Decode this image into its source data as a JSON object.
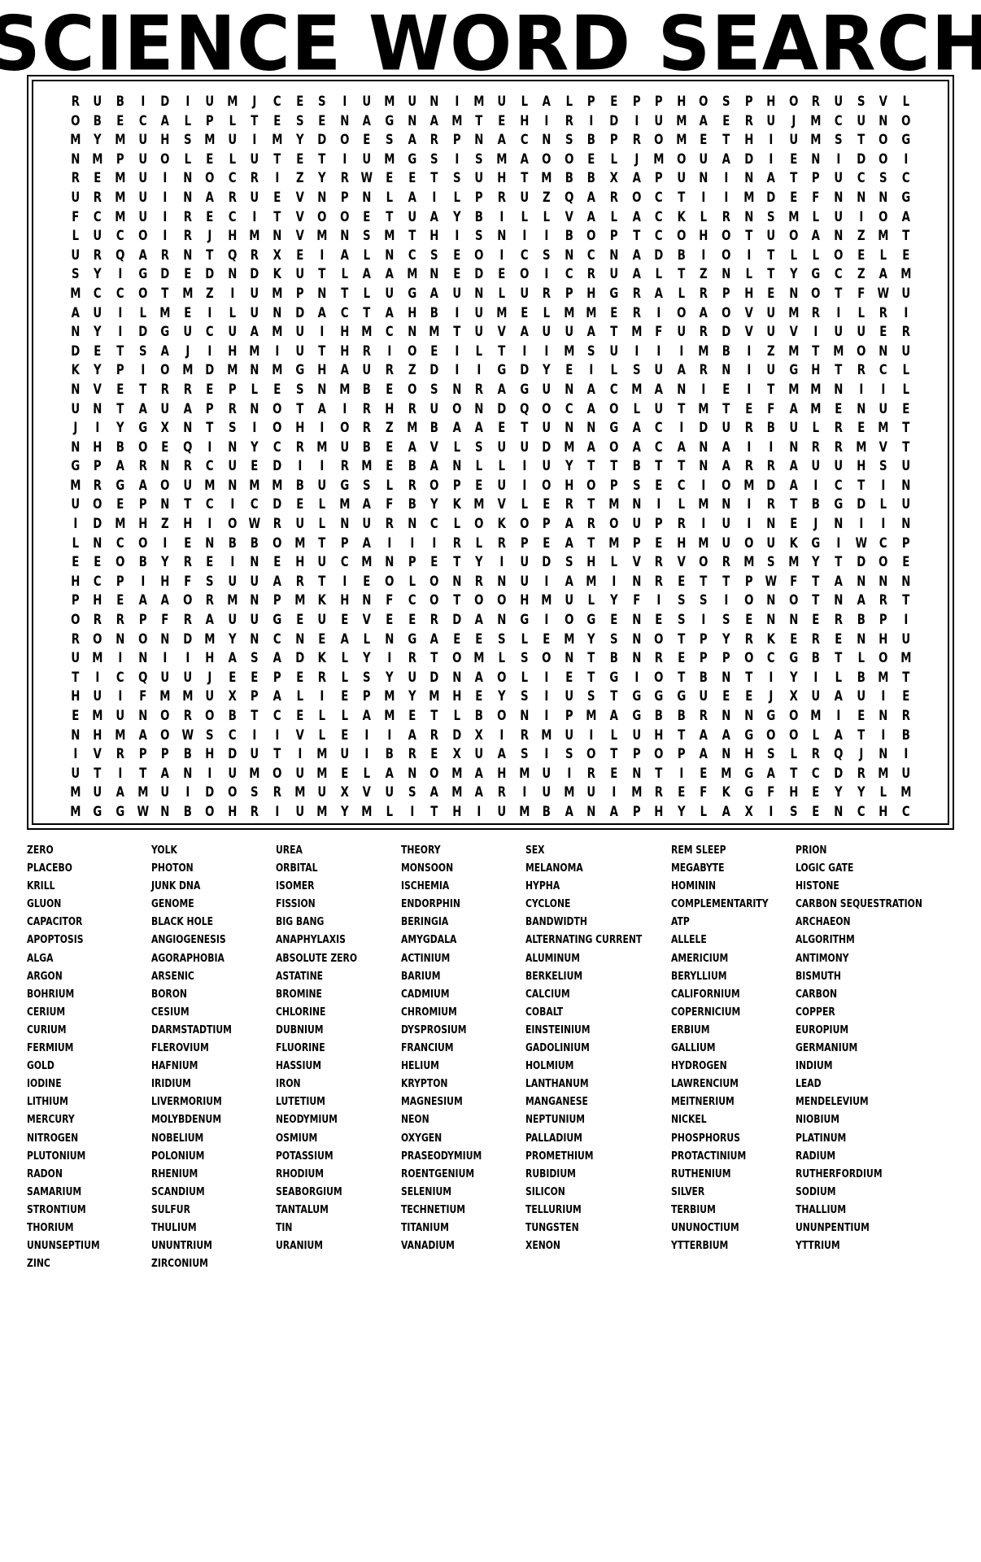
{
  "title": "SCIENCE WORD SEARCH",
  "grid": {
    "rows": 38,
    "cols": 38,
    "letters": [
      "RUBIDIUMJCESIUMUNIMULALPEPPHOSPHORUSVL",
      "OBECALPLTESENAGNAMTEHIRIDIUMAERUJMCUNO",
      "MYMUHSMUIMYDOESARPNACNSBPROMETHIUMSTOG",
      "NMPUOLELUTETIUMGSISMAOOELJMOUADIENIDOI",
      "REMUINOCRIZYRWEETSUHTMBBXAPUNINATPUCSC",
      "URMUINARUEVNPNLAILPRUZQAROCTIIMDEFNNNG",
      "FCMUIRECITVOOETUAYBILLVALACKLRNSMLUIOA",
      "LUCOIRJHMNVMNSMTHISNIIBOPTCOHOTUOANZMT",
      "URQARNTQRXEIALNCSEOICSNCNADBIOITLLOELE",
      "SYIGDEDNDKUTLAAMNEDEOICRUALTZNLTYGCZAM",
      "MCCOTMZIUMPNTLUGAUNLURPHGRALRPHENOTFWU",
      "AUILMEILUNDACTAHBIUMELMMERIOAOVUMRILRI",
      "NYIDGUCUAMUIHMCNMTUVAUUATMFURDVUVIUUER",
      "DETSAJIHMIUTHRIOEILTIIMSUIIIMBIZMTMONU",
      "KYPIOMDMNMGHAURZDIIGDYEILSUARNIUGHTRCL",
      "NVETRREPLESNMBEOSNRAGUNACMANIEITMMNIIL",
      "UNTAUAPRNOTAIRHRUONDQOCAOLUTMTEFAMENUE",
      "JIYGXNTSIOHIORZMBAAETUNNGACIDURBULREMT",
      "NHBOEQINYCRMUBEAVLSUUDMAOACANAIINRRMVT",
      "GPARNRCUEDIIRMEBANLLIUYTTBTTNARRAUUHSU",
      "MRGAOUMNMMBUGSLROPEUIOHOPSECIOMDAICTIN",
      "UOEPNTCICDELMAFBYKMVLERTMNILMNIRTBGDLU",
      "IDMHZHIOWRULNURNCLOKOPAROUPRIUINEJNIIN",
      "LNCOIENBBOMTPAIIIRLRPEATMPEHMUOUKGIWCP",
      "EEOBYREINEHUCMNPETYIUDSHLVRVORMSMYTDOE",
      "HCPIHFSUUARTIEOLONRNUIAMINRETTPWFTANNN",
      "PHEAAORMNPMKHNFCOTOOHMULYFISSIONOTNART",
      "ORRPFRAUUGEUEVEERDANGIOGENESISENNERBPI",
      "RONONDMYNCNEALNGAEESLEMYSNOTPYRKERENHU",
      "UMINIIHASADKLYIRTOMLSONTBNREPPOCGBTLOM",
      "TICQUUJEEPERLSYUDNAOLIETGIOTBNTIYILBMT",
      "HUIFMMUXPALIEPMYMHEYSIUSTGGGUEEJXUAUIE",
      "EMUNOROBTCELLAMETLBONIPMAGBBRNNGOMIENR",
      "NHMAOWSCIIVLEIIARDXIRMUILUHTAAGOOLATIB",
      "IVRPPBHDUTIMUIBREXUASISOTPOPANHSLRQJNI",
      "UTITANIUMOUMELANOMAHMUIRENTIEMGATCDRMU",
      "MUAMUIDOSRMUXVUSAMARIUMUIMREFKGFHEYYLM",
      "MGGWNBOHRIUMYMLITHIUMBANAPHYLAXISENCHC"
    ]
  },
  "wordlist": {
    "columns": [
      [
        "ZERO",
        "PLACEBO",
        "KRILL",
        "GLUON",
        "CAPACITOR",
        "APOPTOSIS",
        "ALGA",
        "ARGON",
        "BOHRIUM",
        "CERIUM",
        "CURIUM",
        "FERMIUM",
        "GOLD",
        "IODINE",
        "LITHIUM",
        "MERCURY",
        "NITROGEN",
        "PLUTONIUM",
        "RADON",
        "SAMARIUM",
        "STRONTIUM",
        "THORIUM",
        "UNUNSEPTIUM",
        "ZINC"
      ],
      [
        "YOLK",
        "PHOTON",
        "JUNK DNA",
        "GENOME",
        "BLACK HOLE",
        "ANGIOGENESIS",
        "AGORAPHOBIA",
        "ARSENIC",
        "BORON",
        "CESIUM",
        "DARMSTADTIUM",
        "FLEROVIUM",
        "HAFNIUM",
        "IRIDIUM",
        "LIVERMORIUM",
        "MOLYBDENUM",
        "NOBELIUM",
        "POLONIUM",
        "RHENIUM",
        "SCANDIUM",
        "SULFUR",
        "THULIUM",
        "UNUNTRIUM",
        "ZIRCONIUM"
      ],
      [
        "UREA",
        "ORBITAL",
        "ISOMER",
        "FISSION",
        "BIG BANG",
        "ANAPHYLAXIS",
        "ABSOLUTE ZERO",
        "ASTATINE",
        "BROMINE",
        "CHLORINE",
        "DUBNIUM",
        "FLUORINE",
        "HASSIUM",
        "IRON",
        "LUTETIUM",
        "NEODYMIUM",
        "OSMIUM",
        "POTASSIUM",
        "RHODIUM",
        "SEABORGIUM",
        "TANTALUM",
        "TIN",
        "URANIUM"
      ],
      [
        "THEORY",
        "MONSOON",
        "ISCHEMIA",
        "ENDORPHIN",
        "BERINGIA",
        "AMYGDALA",
        "ACTINIUM",
        "BARIUM",
        "CADMIUM",
        "CHROMIUM",
        "DYSPROSIUM",
        "FRANCIUM",
        "HELIUM",
        "KRYPTON",
        "MAGNESIUM",
        "NEON",
        "OXYGEN",
        "PRASEODYMIUM",
        "ROENTGENIUM",
        "SELENIUM",
        "TECHNETIUM",
        "TITANIUM",
        "VANADIUM"
      ],
      [
        "SEX",
        "MELANOMA",
        "HYPHA",
        "CYCLONE",
        "BANDWIDTH",
        "ALTERNATING CURRENT",
        "ALUMINUM",
        "BERKELIUM",
        "CALCIUM",
        "COBALT",
        "EINSTEINIUM",
        "GADOLINIUM",
        "HOLMIUM",
        "LANTHANUM",
        "MANGANESE",
        "NEPTUNIUM",
        "PALLADIUM",
        "PROMETHIUM",
        "RUBIDIUM",
        "SILICON",
        "TELLURIUM",
        "TUNGSTEN",
        "XENON"
      ],
      [
        "REM SLEEP",
        "MEGABYTE",
        "HOMININ",
        "COMPLEMENTARITY",
        "ATP",
        "ALLELE",
        "AMERICIUM",
        "BERYLLIUM",
        "CALIFORNIUM",
        "COPERNICIUM",
        "ERBIUM",
        "GALLIUM",
        "HYDROGEN",
        "LAWRENCIUM",
        "MEITNERIUM",
        "NICKEL",
        "PHOSPHORUS",
        "PROTACTINIUM",
        "RUTHENIUM",
        "SILVER",
        "TERBIUM",
        "UNUNOCTIUM",
        "YTTERBIUM"
      ],
      [
        "PRION",
        "LOGIC GATE",
        "HISTONE",
        "CARBON SEQUESTRATION",
        "ARCHAEON",
        "ALGORITHM",
        "ANTIMONY",
        "BISMUTH",
        "CARBON",
        "COPPER",
        "EUROPIUM",
        "GERMANIUM",
        "INDIUM",
        "LEAD",
        "MENDELEVIUM",
        "NIOBIUM",
        "PLATINUM",
        "RADIUM",
        "RUTHERFORDIUM",
        "SODIUM",
        "THALLIUM",
        "UNUNPENTIUM",
        "YTTRIUM"
      ]
    ]
  }
}
